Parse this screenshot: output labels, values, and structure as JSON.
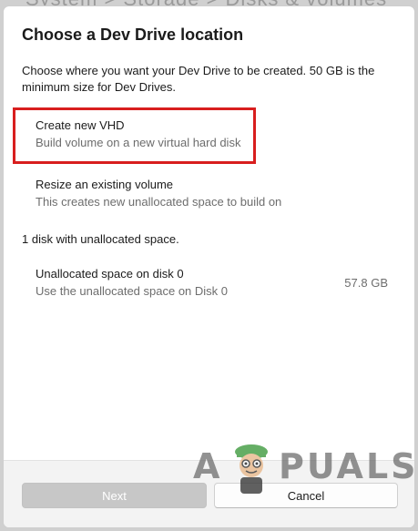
{
  "backdrop": {
    "partial_text": "System  >  Storage  >  Disks & volumes"
  },
  "dialog": {
    "title": "Choose a Dev Drive location",
    "description": "Choose where you want your Dev Drive to be created. 50 GB is the minimum size for Dev Drives.",
    "options": [
      {
        "title": "Create new VHD",
        "subtitle": "Build volume on a new virtual hard disk"
      },
      {
        "title": "Resize an existing volume",
        "subtitle": "This creates new unallocated space to build on"
      }
    ],
    "unallocated_label": "1 disk with unallocated space.",
    "disks": [
      {
        "title": "Unallocated space on disk 0",
        "subtitle": "Use the unallocated space on Disk 0",
        "size": "57.8 GB"
      }
    ],
    "buttons": {
      "next": "Next",
      "cancel": "Cancel"
    }
  },
  "watermark": {
    "left": "A",
    "right": "PUALS"
  },
  "colors": {
    "highlight": "#d81e1e",
    "disabled_button": "#c7c7c7",
    "footer_bg": "#f3f3f3"
  }
}
